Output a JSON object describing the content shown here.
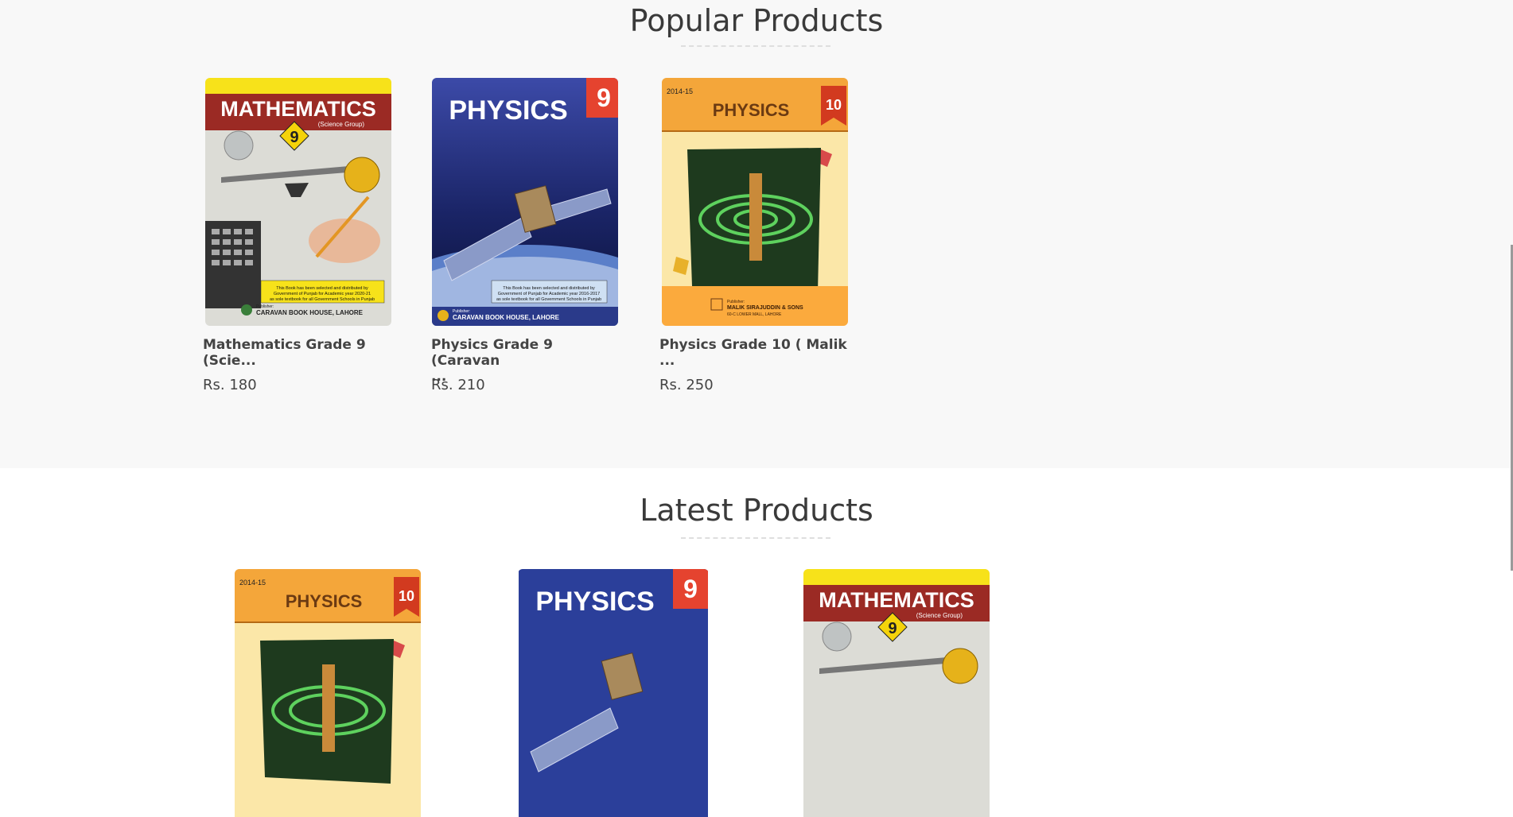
{
  "popular": {
    "heading": "Popular Products",
    "products": [
      {
        "name_line1": "Mathematics Grade 9",
        "name_line2": "(Scie...",
        "price": "Rs. 180",
        "cover": {
          "title": "MATHEMATICS",
          "subtitle": "(Science Group)",
          "grade": "9",
          "publisher_label": "Publisher:",
          "publisher": "CARAVAN BOOK HOUSE, LAHORE",
          "notice": "This Book has been selected and distributed by Government of Punjab for Academic year 2020-21 as sole textbook for all Government Schools in Punjab"
        }
      },
      {
        "name_line1": "Physics Grade 9 (Caravan",
        "name_line2": "...",
        "price": "Rs. 210",
        "cover": {
          "title": "PHYSICS",
          "grade": "9",
          "publisher_label": "Publisher:",
          "publisher": "CARAVAN BOOK HOUSE, LAHORE",
          "notice": "This Book has been selected and distributed by Government of Punjab for Academic year 2016-2017 as sole textbook for all Government Schools in Punjab"
        }
      },
      {
        "name_line1": "Physics Grade 10 ( Malik",
        "name_line2": "...",
        "price": "Rs. 250",
        "cover": {
          "title": "PHYSICS",
          "grade": "10",
          "year": "2014-15",
          "publisher_label": "Publisher:",
          "publisher": "MALIK SIRAJUDDIN & SONS",
          "publisher_address": "60-C LOWER MALL, LAHORE"
        }
      }
    ]
  },
  "latest": {
    "heading": "Latest Products",
    "products": [
      {
        "cover": {
          "title": "PHYSICS",
          "grade": "10",
          "year": "2014-15"
        }
      },
      {
        "cover": {
          "title": "PHYSICS",
          "grade": "9"
        }
      },
      {
        "cover": {
          "title": "MATHEMATICS",
          "subtitle": "(Science Group)",
          "grade": "9"
        }
      }
    ]
  },
  "colors": {
    "popular_bg": "#f8f8f8",
    "math_red": "#9b2a24",
    "math_yellow": "#f7e21a",
    "physics9_blue": "#2b3f9a",
    "physics9_badge": "#e5432f",
    "physics10_orange": "#f4a63a",
    "physics10_bg": "#fbe7a8"
  }
}
